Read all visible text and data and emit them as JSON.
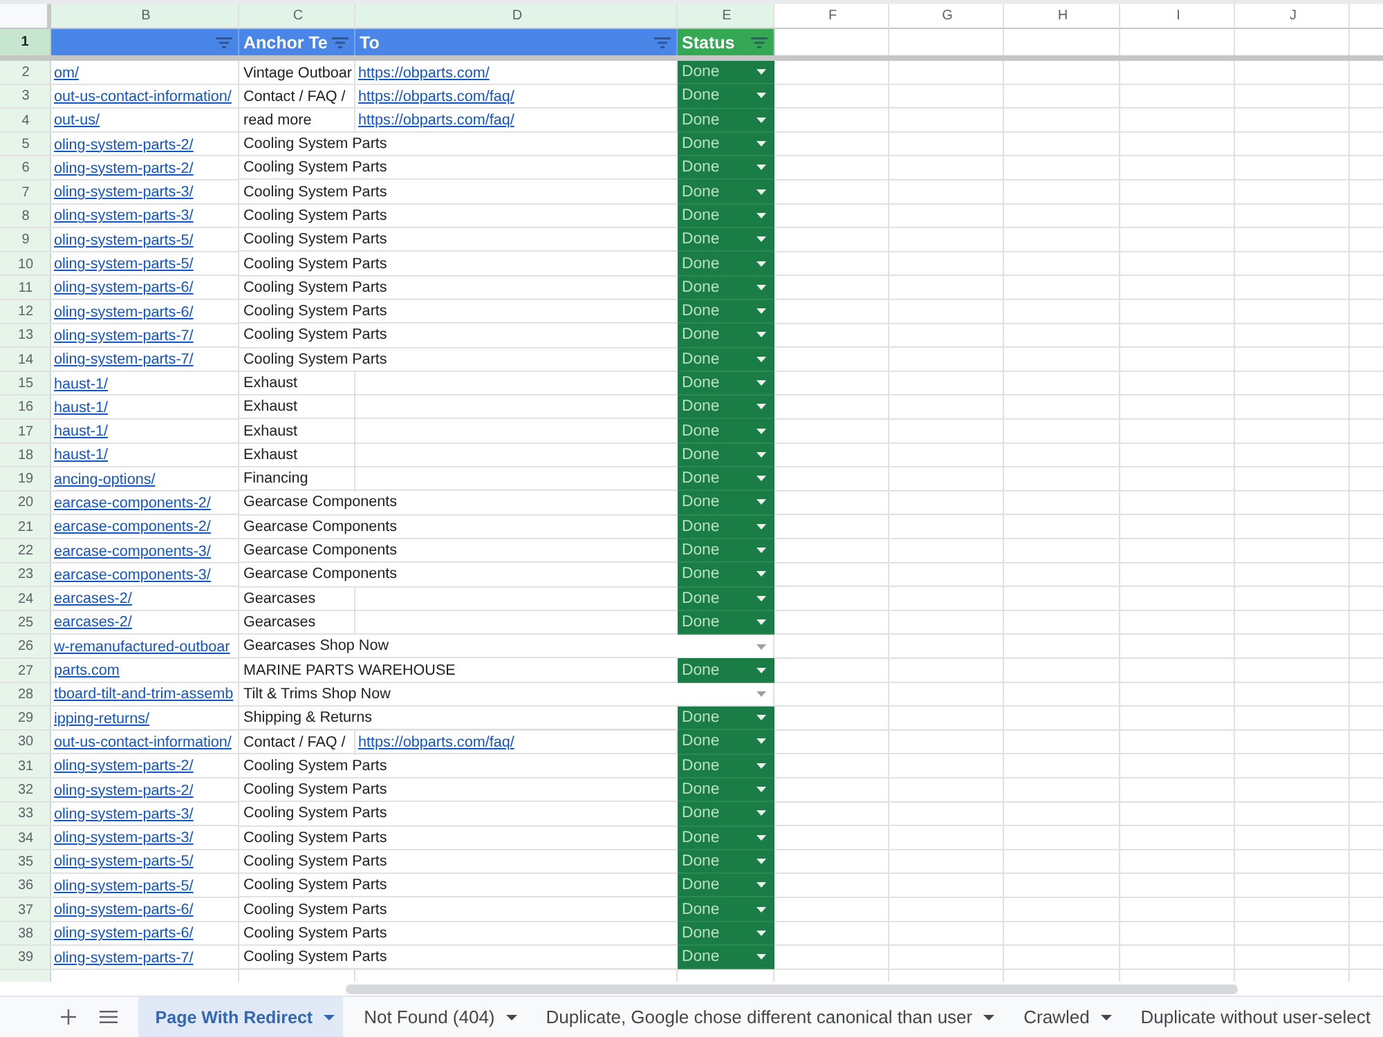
{
  "column_letters": [
    "B",
    "C",
    "D",
    "E",
    "F",
    "G",
    "H",
    "I",
    "J"
  ],
  "header_row": {
    "number": "1",
    "cells": [
      {
        "color": "#4a86e8",
        "filter": true
      },
      {
        "label": "Anchor Te",
        "color": "#4a86e8",
        "filter": true
      },
      {
        "label": "To",
        "color": "#4a86e8",
        "filter": true
      },
      {
        "label": "Status",
        "color": "#34a853",
        "filter": true
      }
    ]
  },
  "rows": [
    {
      "number": "2",
      "column_b": "om/",
      "column_c": "Vintage Outboar",
      "to": "https://obparts.com/",
      "status": "Done"
    },
    {
      "number": "3",
      "column_b": "out-us-contact-information/",
      "column_c": "Contact / FAQ /",
      "to": "https://obparts.com/faq/",
      "status": "Done"
    },
    {
      "number": "4",
      "column_b": "out-us/",
      "column_c": "read more",
      "to": "https://obparts.com/faq/",
      "status": "Done"
    },
    {
      "number": "5",
      "column_b": "oling-system-parts-2/",
      "column_c": "Cooling System Parts",
      "status": "Done"
    },
    {
      "number": "6",
      "column_b": "oling-system-parts-2/",
      "column_c": "Cooling System Parts",
      "status": "Done"
    },
    {
      "number": "7",
      "column_b": "oling-system-parts-3/",
      "column_c": "Cooling System Parts",
      "status": "Done"
    },
    {
      "number": "8",
      "column_b": "oling-system-parts-3/",
      "column_c": "Cooling System Parts",
      "status": "Done"
    },
    {
      "number": "9",
      "column_b": "oling-system-parts-5/",
      "column_c": "Cooling System Parts",
      "status": "Done"
    },
    {
      "number": "10",
      "column_b": "oling-system-parts-5/",
      "column_c": "Cooling System Parts",
      "status": "Done"
    },
    {
      "number": "11",
      "column_b": "oling-system-parts-6/",
      "column_c": "Cooling System Parts",
      "status": "Done"
    },
    {
      "number": "12",
      "column_b": "oling-system-parts-6/",
      "column_c": "Cooling System Parts",
      "status": "Done"
    },
    {
      "number": "13",
      "column_b": "oling-system-parts-7/",
      "column_c": "Cooling System Parts",
      "status": "Done"
    },
    {
      "number": "14",
      "column_b": "oling-system-parts-7/",
      "column_c": "Cooling System Parts",
      "status": "Done"
    },
    {
      "number": "15",
      "column_b": "haust-1/",
      "column_c": "Exhaust",
      "status": "Done"
    },
    {
      "number": "16",
      "column_b": "haust-1/",
      "column_c": "Exhaust",
      "status": "Done"
    },
    {
      "number": "17",
      "column_b": "haust-1/",
      "column_c": "Exhaust",
      "status": "Done"
    },
    {
      "number": "18",
      "column_b": "haust-1/",
      "column_c": "Exhaust",
      "status": "Done"
    },
    {
      "number": "19",
      "column_b": "ancing-options/",
      "column_c": "Financing",
      "status": "Done"
    },
    {
      "number": "20",
      "column_b": "earcase-components-2/",
      "column_c": "Gearcase Components",
      "status": "Done"
    },
    {
      "number": "21",
      "column_b": "earcase-components-2/",
      "column_c": "Gearcase Components",
      "status": "Done"
    },
    {
      "number": "22",
      "column_b": "earcase-components-3/",
      "column_c": "Gearcase Components",
      "status": "Done"
    },
    {
      "number": "23",
      "column_b": "earcase-components-3/",
      "column_c": "Gearcase Components",
      "status": "Done"
    },
    {
      "number": "24",
      "column_b": "earcases-2/",
      "column_c": "Gearcases",
      "status": "Done"
    },
    {
      "number": "25",
      "column_b": "earcases-2/",
      "column_c": "Gearcases",
      "status": "Done"
    },
    {
      "number": "26",
      "column_b": "w-remanufactured-outboar",
      "column_c": "Gearcases Shop Now"
    },
    {
      "number": "27",
      "column_b": "parts.com",
      "column_c": "MARINE PARTS WAREHOUSE",
      "status": "Done"
    },
    {
      "number": "28",
      "column_b": "tboard-tilt-and-trim-assemb",
      "column_c": "Tilt & Trims Shop Now"
    },
    {
      "number": "29",
      "column_b": "ipping-returns/",
      "column_c": "Shipping & Returns",
      "status": "Done"
    },
    {
      "number": "30",
      "column_b": "out-us-contact-information/",
      "column_c": "Contact / FAQ /",
      "to": "https://obparts.com/faq/",
      "status": "Done"
    },
    {
      "number": "31",
      "column_b": "oling-system-parts-2/",
      "column_c": "Cooling System Parts",
      "status": "Done"
    },
    {
      "number": "32",
      "column_b": "oling-system-parts-2/",
      "column_c": "Cooling System Parts",
      "status": "Done"
    },
    {
      "number": "33",
      "column_b": "oling-system-parts-3/",
      "column_c": "Cooling System Parts",
      "status": "Done"
    },
    {
      "number": "34",
      "column_b": "oling-system-parts-3/",
      "column_c": "Cooling System Parts",
      "status": "Done"
    },
    {
      "number": "35",
      "column_b": "oling-system-parts-5/",
      "column_c": "Cooling System Parts",
      "status": "Done"
    },
    {
      "number": "36",
      "column_b": "oling-system-parts-5/",
      "column_c": "Cooling System Parts",
      "status": "Done"
    },
    {
      "number": "37",
      "column_b": "oling-system-parts-6/",
      "column_c": "Cooling System Parts",
      "status": "Done"
    },
    {
      "number": "38",
      "column_b": "oling-system-parts-6/",
      "column_c": "Cooling System Parts",
      "status": "Done"
    },
    {
      "number": "39",
      "column_b": "oling-system-parts-7/",
      "column_c": "Cooling System Parts",
      "status": "Done"
    }
  ],
  "sheet_tabs": [
    {
      "label": "Page With Redirect",
      "selected": true,
      "caret": true
    },
    {
      "label": "Not Found (404)",
      "selected": false,
      "caret": true
    },
    {
      "label": "Duplicate, Google chose different canonical than user",
      "selected": false,
      "caret": true
    },
    {
      "label": "Crawled",
      "selected": false,
      "caret": true
    },
    {
      "label": "Duplicate without user-select",
      "selected": false,
      "caret": false
    }
  ]
}
